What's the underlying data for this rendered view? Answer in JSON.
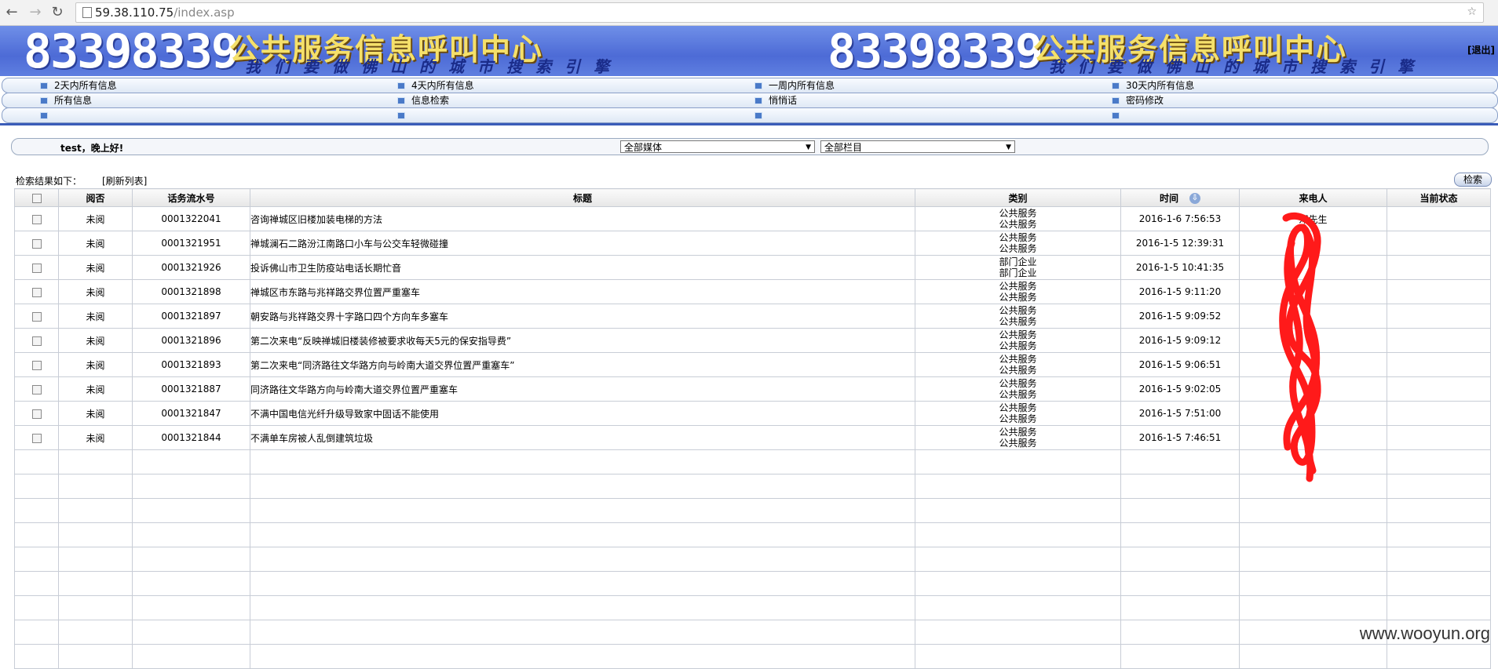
{
  "browser": {
    "url_host": "59.38.110.75",
    "url_path": "/index.asp"
  },
  "banner": {
    "phone": "83398339",
    "title": "公共服务信息呼叫中心",
    "subtitle": "我们要做佛山的城市搜索引擎",
    "logout": "[退出]"
  },
  "menu": {
    "row1": [
      "2天内所有信息",
      "4天内所有信息",
      "一周内所有信息",
      "30天内所有信息"
    ],
    "row2": [
      "所有信息",
      "信息检索",
      "悄悄话",
      "密码修改"
    ]
  },
  "filter": {
    "greeting": "test，晚上好!",
    "media_select": "全部媒体",
    "column_select": "全部栏目"
  },
  "results": {
    "label": "检索结果如下：",
    "refresh": "[刷新列表]",
    "search_button": "检索"
  },
  "table": {
    "headers": [
      "阅否",
      "话务流水号",
      "标题",
      "类别",
      "时间",
      "来电人",
      "当前状态"
    ],
    "rows": [
      {
        "read": "未阅",
        "id": "0001322041",
        "title": "咨询禅城区旧楼加装电梯的方法",
        "cat1": "公共服务",
        "cat2": "公共服务",
        "time": "2016-1-6 7:56:53",
        "caller": "邓先生",
        "status": ""
      },
      {
        "read": "未阅",
        "id": "0001321951",
        "title": "禅城澜石二路汾江南路口小车与公交车轻微碰撞",
        "cat1": "公共服务",
        "cat2": "公共服务",
        "time": "2016-1-5 12:39:31",
        "caller": "",
        "status": ""
      },
      {
        "read": "未阅",
        "id": "0001321926",
        "title": "投诉佛山市卫生防疫站电话长期忙音",
        "cat1": "部门企业",
        "cat2": "部门企业",
        "time": "2016-1-5 10:41:35",
        "caller": "",
        "status": ""
      },
      {
        "read": "未阅",
        "id": "0001321898",
        "title": "禅城区市东路与兆祥路交界位置严重塞车",
        "cat1": "公共服务",
        "cat2": "公共服务",
        "time": "2016-1-5 9:11:20",
        "caller": "",
        "status": ""
      },
      {
        "read": "未阅",
        "id": "0001321897",
        "title": "朝安路与兆祥路交界十字路口四个方向车多塞车",
        "cat1": "公共服务",
        "cat2": "公共服务",
        "time": "2016-1-5 9:09:52",
        "caller": "",
        "status": ""
      },
      {
        "read": "未阅",
        "id": "0001321896",
        "title": "第二次来电“反映禅城旧楼装修被要求收每天5元的保安指导费”",
        "cat1": "公共服务",
        "cat2": "公共服务",
        "time": "2016-1-5 9:09:12",
        "caller": "",
        "status": ""
      },
      {
        "read": "未阅",
        "id": "0001321893",
        "title": "第二次来电“同济路往文华路方向与岭南大道交界位置严重塞车”",
        "cat1": "公共服务",
        "cat2": "公共服务",
        "time": "2016-1-5 9:06:51",
        "caller": "",
        "status": ""
      },
      {
        "read": "未阅",
        "id": "0001321887",
        "title": "同济路往文华路方向与岭南大道交界位置严重塞车",
        "cat1": "公共服务",
        "cat2": "公共服务",
        "time": "2016-1-5 9:02:05",
        "caller": "",
        "status": ""
      },
      {
        "read": "未阅",
        "id": "0001321847",
        "title": "不满中国电信光纤升级导致家中固话不能使用",
        "cat1": "公共服务",
        "cat2": "公共服务",
        "time": "2016-1-5 7:51:00",
        "caller": "",
        "status": ""
      },
      {
        "read": "未阅",
        "id": "0001321844",
        "title": "不满单车房被人乱倒建筑垃圾",
        "cat1": "公共服务",
        "cat2": "公共服务",
        "time": "2016-1-5 7:46:51",
        "caller": "",
        "status": ""
      }
    ]
  },
  "watermark": "www.wooyun.org",
  "colors": {
    "banner_blue": "#5574dc",
    "banner_yellow": "#f5e06a",
    "scribble_red": "#ff1a1a"
  }
}
